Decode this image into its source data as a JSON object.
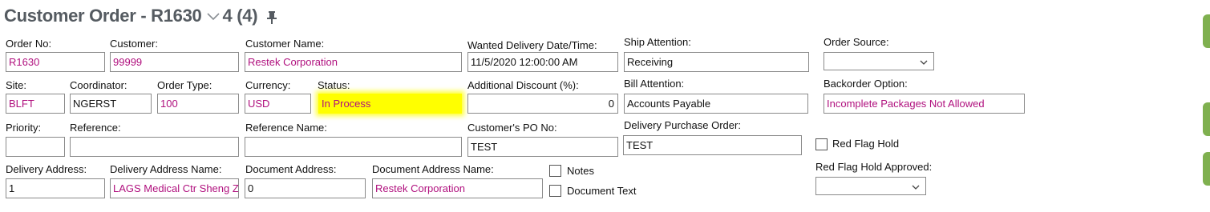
{
  "header": {
    "title": "Customer Order - R1630",
    "record_position": "4 (4)",
    "icons": [
      "chevron-down-icon",
      "pin-icon"
    ]
  },
  "form": {
    "order_no": {
      "label": "Order No:",
      "value": "R1630"
    },
    "customer": {
      "label": "Customer:",
      "value": "99999"
    },
    "customer_name": {
      "label": "Customer Name:",
      "value": "Restek Corporation"
    },
    "wanted_delivery": {
      "label": "Wanted Delivery Date/Time:",
      "value": "11/5/2020 12:00:00 AM"
    },
    "ship_attention": {
      "label": "Ship Attention:",
      "value": "Receiving"
    },
    "order_source": {
      "label": "Order Source:",
      "value": ""
    },
    "site": {
      "label": "Site:",
      "value": "BLFT"
    },
    "coordinator": {
      "label": "Coordinator:",
      "value": "NGERST"
    },
    "order_type": {
      "label": "Order Type:",
      "value": "100"
    },
    "currency": {
      "label": "Currency:",
      "value": "USD"
    },
    "status": {
      "label": "Status:",
      "value": "In Process"
    },
    "additional_discount": {
      "label": "Additional Discount (%):",
      "value": "0"
    },
    "bill_attention": {
      "label": "Bill Attention:",
      "value": "Accounts Payable"
    },
    "backorder_option": {
      "label": "Backorder Option:",
      "value": "Incomplete Packages Not Allowed"
    },
    "priority": {
      "label": "Priority:",
      "value": ""
    },
    "reference": {
      "label": "Reference:",
      "value": ""
    },
    "reference_name": {
      "label": "Reference Name:",
      "value": ""
    },
    "customer_po": {
      "label": "Customer's PO No:",
      "value": "TEST"
    },
    "delivery_po": {
      "label": "Delivery Purchase Order:",
      "value": "TEST"
    },
    "red_flag_hold": {
      "label": "Red Flag Hold",
      "checked": false
    },
    "delivery_address": {
      "label": "Delivery Address:",
      "value": "1"
    },
    "delivery_address_name": {
      "label": "Delivery Address Name:",
      "value": "LAGS Medical Ctr Sheng Z"
    },
    "document_address": {
      "label": "Document Address:",
      "value": "0"
    },
    "document_address_name": {
      "label": "Document Address Name:",
      "value": "Restek Corporation"
    },
    "notes": {
      "label": "Notes",
      "checked": false
    },
    "document_text": {
      "label": "Document Text",
      "checked": false
    },
    "red_flag_hold_approved": {
      "label": "Red Flag Hold Approved:",
      "value": ""
    }
  },
  "colors": {
    "title": "#555b61",
    "lov_value": "#b0107e",
    "status_highlight": "#ffff00",
    "edge_accent": "#7fb04f"
  }
}
